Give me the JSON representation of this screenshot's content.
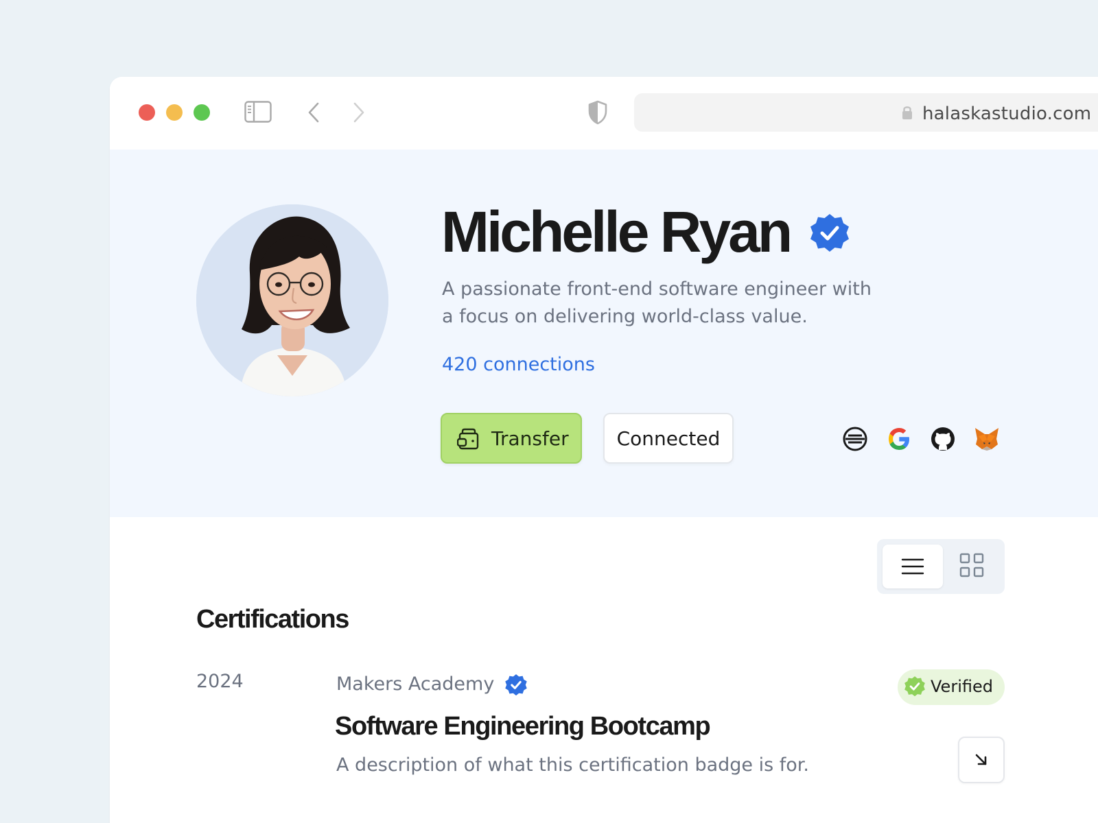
{
  "browser": {
    "url": "halaskastudio.com",
    "icons": {
      "sidebar": "sidebar-toggle-icon",
      "back": "chevron-left-icon",
      "forward": "chevron-right-icon",
      "shield": "shield-icon",
      "lock": "lock-icon"
    }
  },
  "profile": {
    "name": "Michelle Ryan",
    "bio": "A passionate front-end software engineer with a focus on delivering world-class value.",
    "connections": "420 connections",
    "transfer_label": "Transfer",
    "connected_label": "Connected",
    "social_links": [
      "ethereum-icon",
      "google-icon",
      "github-icon",
      "metamask-icon"
    ]
  },
  "view_toggle": {
    "active": "list",
    "options": [
      "list",
      "grid"
    ]
  },
  "certifications": {
    "title": "Certifications",
    "items": [
      {
        "year": "2024",
        "issuer": "Makers Academy",
        "title": "Software Engineering Bootcamp",
        "description": "A description of what this certification badge is for.",
        "status": "Verified"
      }
    ]
  },
  "colors": {
    "page_background": "#ebf2f6",
    "hero_background": "#f2f7fe",
    "accent_blue": "#2f6fe0",
    "transfer_green": "#b7e37c",
    "verified_green": "#8ed15a"
  }
}
